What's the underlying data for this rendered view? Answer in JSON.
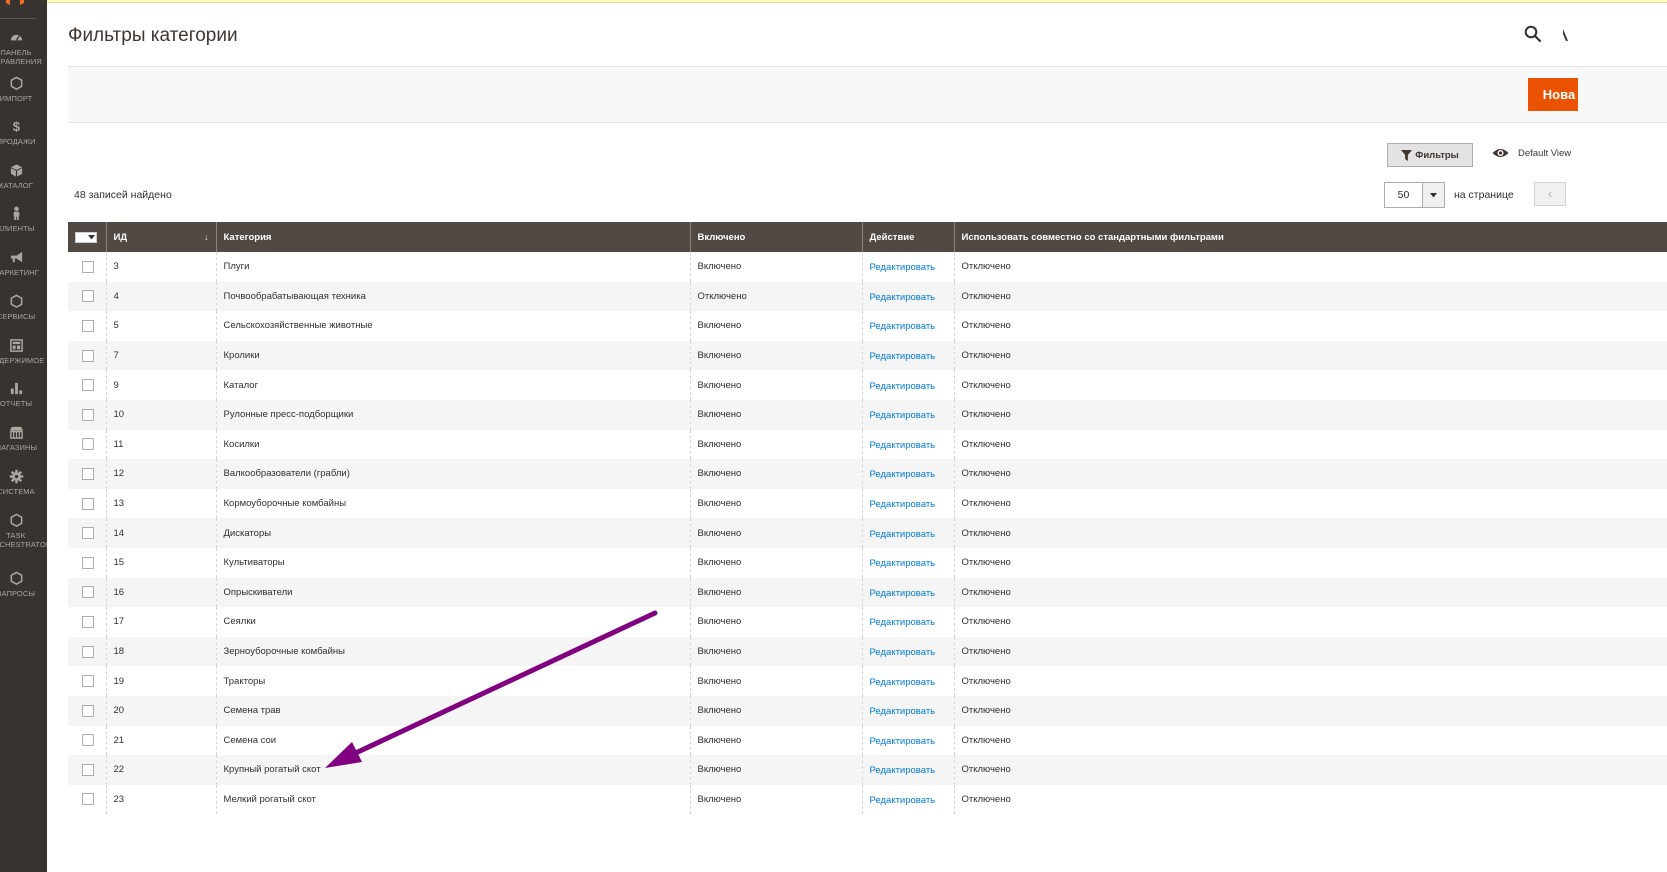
{
  "sidebar": {
    "items": [
      {
        "label": "ПАНЕЛЬ УПРАВЛЕНИЯ",
        "icon": "dashboard-icon"
      },
      {
        "label": "ИМПОРТ",
        "icon": "hexagon-icon"
      },
      {
        "label": "ПРОДАЖИ",
        "icon": "dollar-icon"
      },
      {
        "label": "КАТАЛОГ",
        "icon": "box-icon"
      },
      {
        "label": "КЛИЕНТЫ",
        "icon": "person-icon"
      },
      {
        "label": "МАРКЕТИНГ",
        "icon": "megaphone-icon"
      },
      {
        "label": "СЕРВИСЫ",
        "icon": "hexagon-icon"
      },
      {
        "label": "СОДЕРЖИМОЕ",
        "icon": "layout-icon"
      },
      {
        "label": "ОТЧЕТЫ",
        "icon": "bar-chart-icon"
      },
      {
        "label": "МАГАЗИНЫ",
        "icon": "store-icon"
      },
      {
        "label": "СИСТЕМА",
        "icon": "gear-icon"
      },
      {
        "label": "TASK ORCHESTRATOR",
        "icon": "hexagon-icon"
      },
      {
        "label": "ЗАПРОСЫ",
        "icon": "hexagon-icon"
      }
    ]
  },
  "header": {
    "title": "Фильтры категории"
  },
  "actions": {
    "new_button_label": "Нова"
  },
  "toolbar": {
    "filters_label": "Фильтры",
    "view_label": "Default View",
    "records_found": "48 записей найдено",
    "per_page_value": "50",
    "per_page_label": "на странице"
  },
  "grid": {
    "columns": [
      "ИД",
      "Категория",
      "Включено",
      "Действие",
      "Использовать совместно со стандартными фильтрами"
    ],
    "rows": [
      {
        "id": "3",
        "category": "Плуги",
        "enabled": "Включено",
        "action": "Редактировать",
        "shared": "Отключено"
      },
      {
        "id": "4",
        "category": "Почвообрабатывающая техника",
        "enabled": "Отключено",
        "action": "Редактировать",
        "shared": "Отключено"
      },
      {
        "id": "5",
        "category": "Сельскохозяйственные животные",
        "enabled": "Включено",
        "action": "Редактировать",
        "shared": "Отключено"
      },
      {
        "id": "7",
        "category": "Кролики",
        "enabled": "Включено",
        "action": "Редактировать",
        "shared": "Отключено"
      },
      {
        "id": "9",
        "category": "Каталог",
        "enabled": "Включено",
        "action": "Редактировать",
        "shared": "Отключено"
      },
      {
        "id": "10",
        "category": "Рулонные пресс-подборщики",
        "enabled": "Включено",
        "action": "Редактировать",
        "shared": "Отключено"
      },
      {
        "id": "11",
        "category": "Косилки",
        "enabled": "Включено",
        "action": "Редактировать",
        "shared": "Отключено"
      },
      {
        "id": "12",
        "category": "Валкообразователи (грабли)",
        "enabled": "Включено",
        "action": "Редактировать",
        "shared": "Отключено"
      },
      {
        "id": "13",
        "category": "Кормоуборочные комбайны",
        "enabled": "Включено",
        "action": "Редактировать",
        "shared": "Отключено"
      },
      {
        "id": "14",
        "category": "Дискаторы",
        "enabled": "Включено",
        "action": "Редактировать",
        "shared": "Отключено"
      },
      {
        "id": "15",
        "category": "Культиваторы",
        "enabled": "Включено",
        "action": "Редактировать",
        "shared": "Отключено"
      },
      {
        "id": "16",
        "category": "Опрыскиватели",
        "enabled": "Включено",
        "action": "Редактировать",
        "shared": "Отключено"
      },
      {
        "id": "17",
        "category": "Сеялки",
        "enabled": "Включено",
        "action": "Редактировать",
        "shared": "Отключено"
      },
      {
        "id": "18",
        "category": "Зерноуборочные комбайны",
        "enabled": "Включено",
        "action": "Редактировать",
        "shared": "Отключено"
      },
      {
        "id": "19",
        "category": "Тракторы",
        "enabled": "Включено",
        "action": "Редактировать",
        "shared": "Отключено"
      },
      {
        "id": "20",
        "category": "Семена трав",
        "enabled": "Включено",
        "action": "Редактировать",
        "shared": "Отключено"
      },
      {
        "id": "21",
        "category": "Семена сои",
        "enabled": "Включено",
        "action": "Редактировать",
        "shared": "Отключено"
      },
      {
        "id": "22",
        "category": "Крупный рогатый скот",
        "enabled": "Включено",
        "action": "Редактировать",
        "shared": "Отключено"
      },
      {
        "id": "23",
        "category": "Мелкий рогатый скот",
        "enabled": "Включено",
        "action": "Редактировать",
        "shared": "Отключено"
      }
    ]
  },
  "colors": {
    "sidebar_bg": "#373330",
    "header_bg": "#514943",
    "accent": "#eb5202",
    "link": "#007bdb",
    "annotation_arrow": "#800080"
  }
}
